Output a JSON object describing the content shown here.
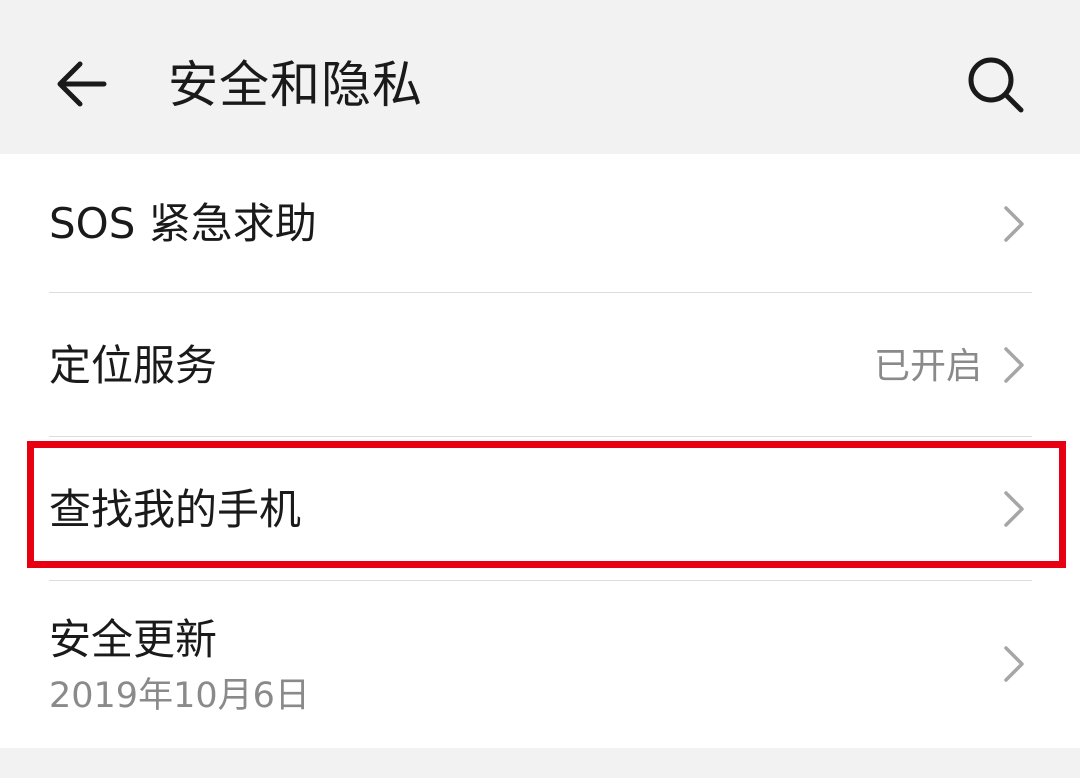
{
  "header": {
    "title": "安全和隐私",
    "back_icon": "arrow-left-icon",
    "search_icon": "search-icon"
  },
  "items": [
    {
      "title": "SOS 紧急求助",
      "value": "",
      "subtitle": ""
    },
    {
      "title": "定位服务",
      "value": "已开启",
      "subtitle": ""
    },
    {
      "title": "查找我的手机",
      "value": "",
      "subtitle": ""
    },
    {
      "title": "安全更新",
      "value": "",
      "subtitle": "2019年10月6日"
    }
  ],
  "highlight": {
    "target": "查找我的手机",
    "color": "#e60012"
  }
}
